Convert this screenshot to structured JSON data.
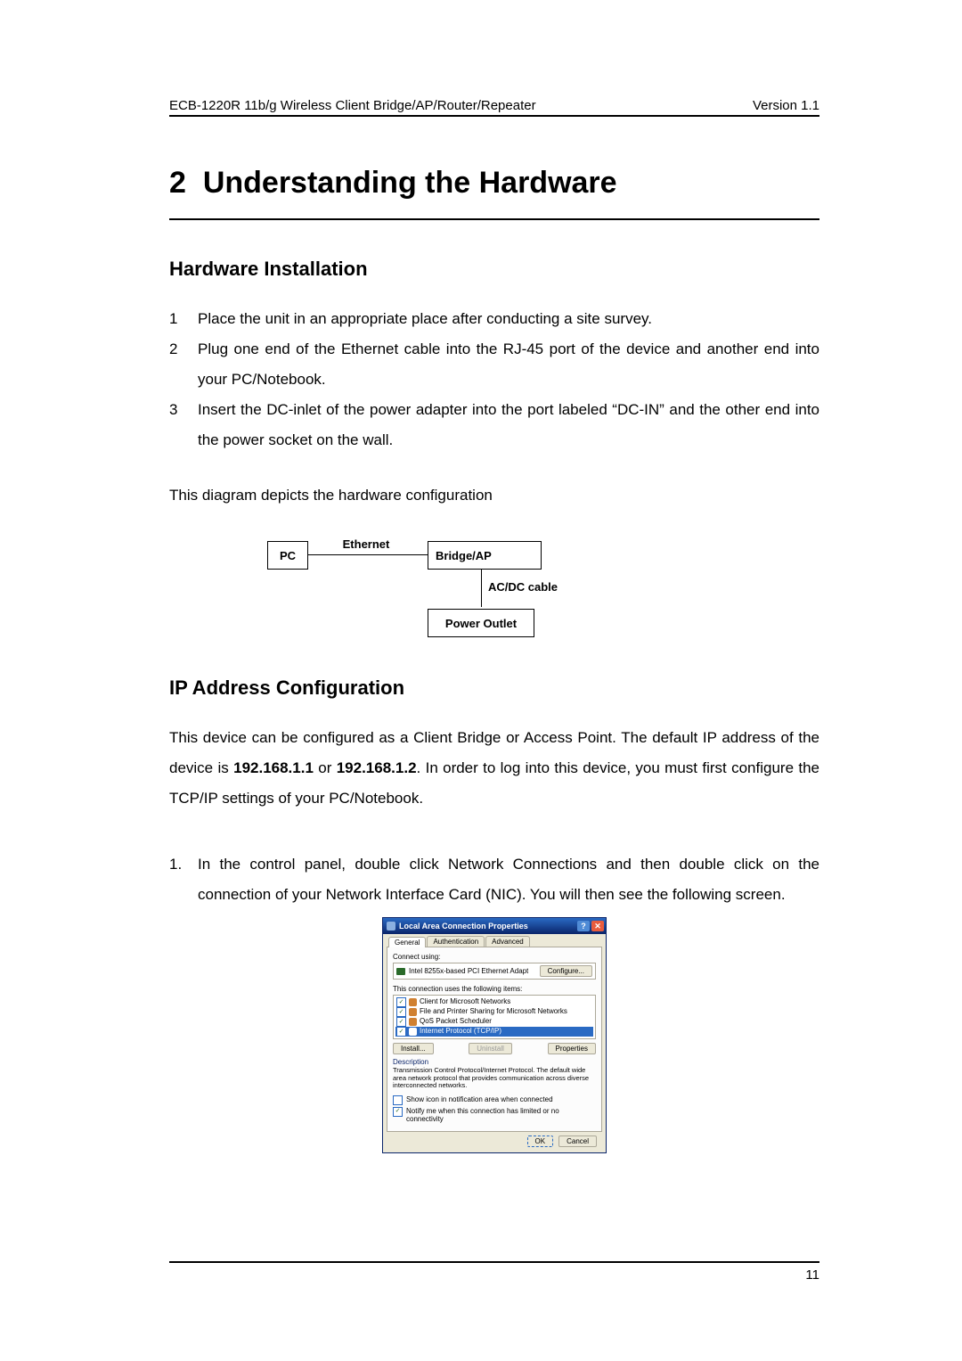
{
  "header": {
    "left": "ECB-1220R 11b/g Wireless Client Bridge/AP/Router/Repeater",
    "right": "Version 1.1"
  },
  "chapter": {
    "number": "2",
    "title": "Understanding the Hardware"
  },
  "section1": {
    "title": "Hardware Installation",
    "steps": [
      "Place the unit in an appropriate place after conducting a site survey.",
      "Plug one end of the Ethernet cable into the RJ-45 port of the device and another end into your PC/Notebook.",
      "Insert the DC-inlet of the power adapter into the port labeled “DC-IN” and the other end into the power socket on the wall."
    ],
    "post": "This diagram depicts the hardware configuration"
  },
  "diagram": {
    "pc": "PC",
    "ethernet": "Ethernet",
    "bridge": "Bridge/AP",
    "acdc": "AC/DC cable",
    "outlet": "Power Outlet"
  },
  "section2": {
    "title": "IP Address Configuration",
    "intro_parts": [
      "This device can be configured as a Client Bridge or Access Point.  The default IP address of the device is ",
      "192.168.1.1",
      " or ",
      "192.168.1.2",
      ". In order to log into this device, you must first configure the TCP/IP settings of your PC/Notebook."
    ],
    "step1_num": "1.",
    "step1": "In the control panel, double click Network Connections and then double click on the connection of your Network Interface Card (NIC). You will then see the following screen."
  },
  "dialog": {
    "title": "Local Area Connection Properties",
    "help_glyph": "?",
    "close_glyph": "✕",
    "tabs": [
      "General",
      "Authentication",
      "Advanced"
    ],
    "connect_using_label": "Connect using:",
    "adapter": "Intel 8255x-based PCI Ethernet Adapt",
    "configure": "Configure...",
    "uses_label": "This connection uses the following items:",
    "items": [
      {
        "label": "Client for Microsoft Networks",
        "checked": true,
        "selected": false
      },
      {
        "label": "File and Printer Sharing for Microsoft Networks",
        "checked": true,
        "selected": false
      },
      {
        "label": "QoS Packet Scheduler",
        "checked": true,
        "selected": false
      },
      {
        "label": "Internet Protocol (TCP/IP)",
        "checked": true,
        "selected": true
      }
    ],
    "install": "Install...",
    "uninstall": "Uninstall",
    "properties": "Properties",
    "desc_head": "Description",
    "desc": "Transmission Control Protocol/Internet Protocol. The default wide area network protocol that provides communication across diverse interconnected networks.",
    "show_icon": "Show icon in notification area when connected",
    "notify": "Notify me when this connection has limited or no connectivity",
    "ok": "OK",
    "cancel": "Cancel"
  },
  "page_number": "11"
}
